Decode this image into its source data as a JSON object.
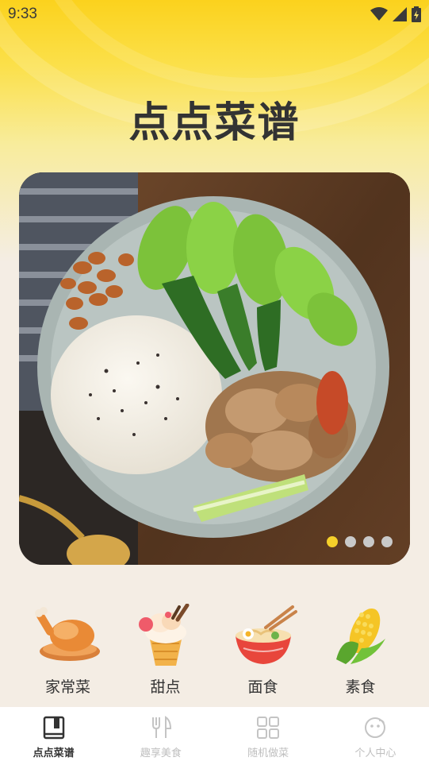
{
  "status_bar": {
    "time": "9:33",
    "icons": [
      "wifi-icon",
      "signal-icon",
      "battery-charging-icon"
    ]
  },
  "header": {
    "title": "点点菜谱"
  },
  "banner": {
    "page_count": 4,
    "active_index": 0,
    "image": "rice-with-pork-and-bok-choy-photo"
  },
  "categories": [
    {
      "label": "家常菜",
      "icon": "roast-chicken-icon"
    },
    {
      "label": "甜点",
      "icon": "ice-cream-icon"
    },
    {
      "label": "面食",
      "icon": "noodle-bowl-icon"
    },
    {
      "label": "素食",
      "icon": "corn-icon"
    }
  ],
  "tabbar": {
    "tabs": [
      {
        "label": "点点菜谱",
        "icon": "book-icon",
        "active": true
      },
      {
        "label": "趣享美食",
        "icon": "fork-knife-icon",
        "active": false
      },
      {
        "label": "随机做菜",
        "icon": "grid-icon",
        "active": false
      },
      {
        "label": "个人中心",
        "icon": "smiley-icon",
        "active": false
      }
    ]
  },
  "colors": {
    "accent_yellow": "#fbd21d",
    "active_dot": "#f5d02a",
    "text_dark": "#333333",
    "tab_inactive": "#bfbfbf"
  }
}
